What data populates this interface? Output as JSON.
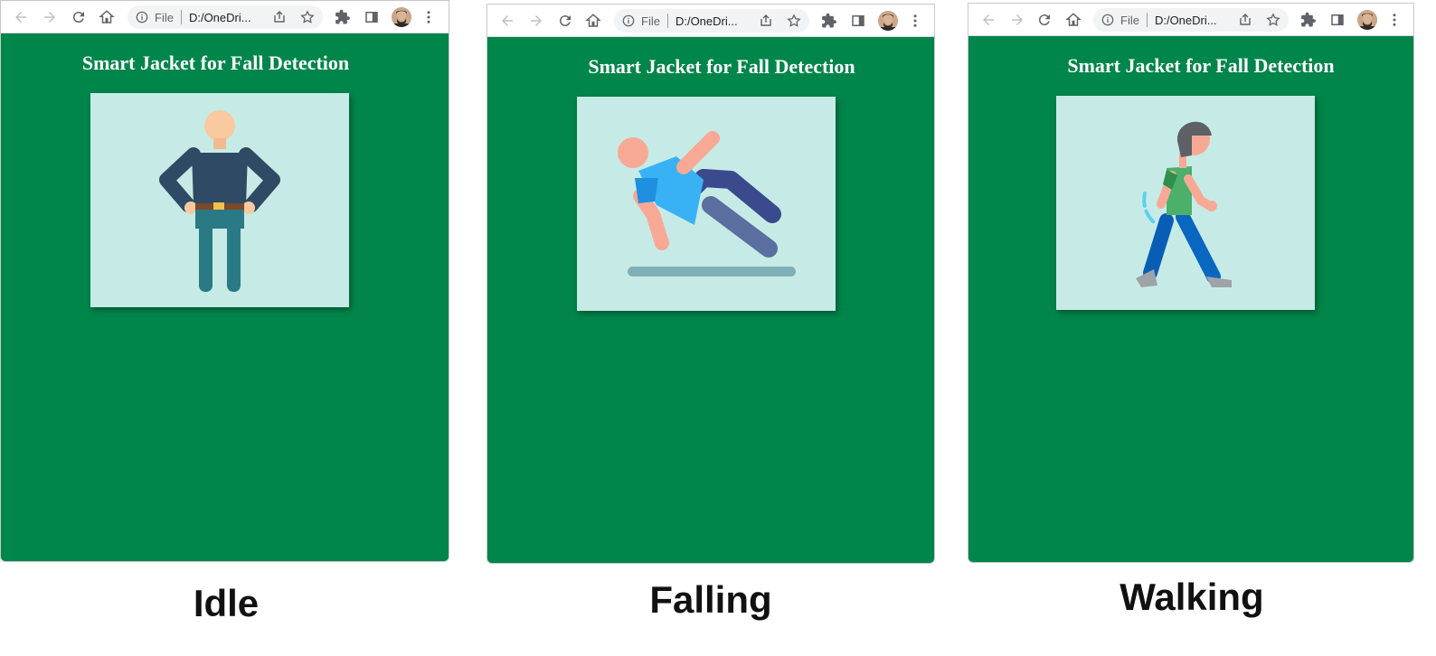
{
  "colors": {
    "page_background": "#00854a",
    "image_background": "#c6ebe6",
    "title_color": "#ffffff",
    "caption_color": "#111111"
  },
  "panels": [
    {
      "browser": {
        "omnibox_scheme": "File",
        "omnibox_url": "D:/OneDri...",
        "icons": [
          "back-icon",
          "forward-icon",
          "reload-icon",
          "home-icon",
          "info-icon",
          "share-icon",
          "star-icon",
          "extensions-icon",
          "side-panel-icon",
          "profile-avatar",
          "menu-icon"
        ]
      },
      "page_title": "Smart Jacket for Fall Detection",
      "illustration": "person-standing-idle",
      "caption": "Idle"
    },
    {
      "browser": {
        "omnibox_scheme": "File",
        "omnibox_url": "D:/OneDri...",
        "icons": [
          "back-icon",
          "forward-icon",
          "reload-icon",
          "home-icon",
          "info-icon",
          "share-icon",
          "star-icon",
          "extensions-icon",
          "side-panel-icon",
          "profile-avatar",
          "menu-icon"
        ]
      },
      "page_title": "Smart Jacket for Fall Detection",
      "illustration": "person-falling",
      "caption": "Falling"
    },
    {
      "browser": {
        "omnibox_scheme": "File",
        "omnibox_url": "D:/OneDri...",
        "icons": [
          "back-icon",
          "forward-icon",
          "reload-icon",
          "home-icon",
          "info-icon",
          "share-icon",
          "star-icon",
          "extensions-icon",
          "side-panel-icon",
          "profile-avatar",
          "menu-icon"
        ]
      },
      "page_title": "Smart Jacket for Fall Detection",
      "illustration": "person-walking",
      "caption": "Walking"
    }
  ]
}
